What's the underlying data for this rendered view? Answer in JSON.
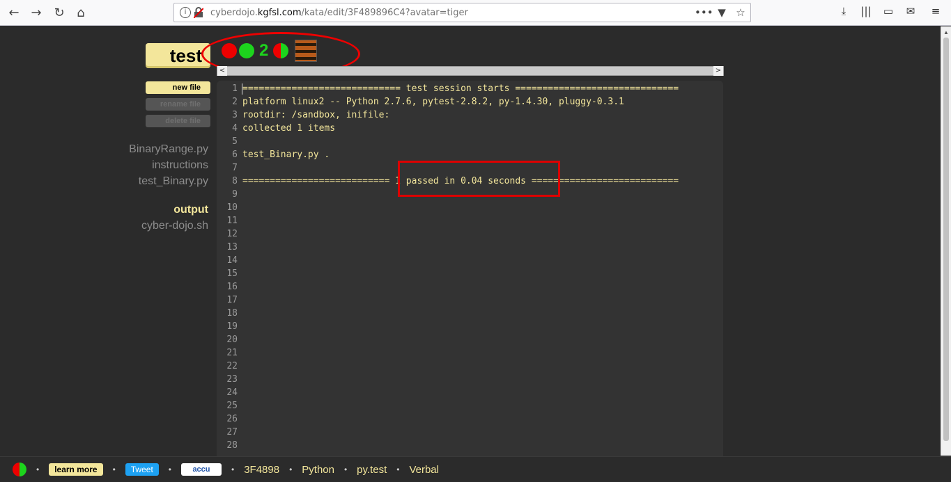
{
  "browser": {
    "url_prefix": "cyberdojo.",
    "url_domain": "kgfsl.com",
    "url_path": "/kata/edit/3F489896C4?avatar=tiger",
    "icons": {
      "back": "←",
      "forward": "→",
      "reload": "↻",
      "home": "⌂",
      "more": "•••",
      "bookmark": "☆",
      "download": "⤓",
      "library": "|||",
      "sidebar": "▭",
      "mail": "✉",
      "menu": "≡",
      "info": "i",
      "pocket": "▼"
    }
  },
  "app": {
    "test_button": "test",
    "new_file": "new file",
    "rename_file": "rename file",
    "delete_file": "delete file",
    "files": [
      "BinaryRange.py",
      "instructions",
      "test_Binary.py"
    ],
    "output_files": [
      "output",
      "cyber-dojo.sh"
    ],
    "selected_file": "output",
    "traffic_count": "2",
    "avatar": "tiger"
  },
  "editor": {
    "lines": [
      "============================= test session starts ==============================",
      "platform linux2 -- Python 2.7.6, pytest-2.8.2, py-1.4.30, pluggy-0.3.1",
      "rootdir: /sandbox, inifile:",
      "collected 1 items",
      "",
      "test_Binary.py .",
      "",
      "=========================== 1 passed in 0.04 seconds ===========================",
      "",
      "",
      "",
      "",
      "",
      "",
      "",
      "",
      "",
      "",
      "",
      "",
      "",
      "",
      "",
      "",
      "",
      "",
      "",
      "",
      ""
    ],
    "line_numbers": [
      "1",
      "2",
      "3",
      "4",
      "5",
      "6",
      "7",
      "8",
      "9",
      "10",
      "11",
      "12",
      "13",
      "14",
      "15",
      "16",
      "17",
      "18",
      "19",
      "20",
      "21",
      "22",
      "23",
      "24",
      "25",
      "26",
      "27",
      "28"
    ]
  },
  "footer": {
    "learn_more": "learn more",
    "tweet": "Tweet",
    "accu": "accu",
    "kata_id": "3F4898",
    "language": "Python",
    "test_framework": "py.test",
    "exercise": "Verbal",
    "separator": "•"
  },
  "colors": {
    "accent": "#f3e69b",
    "red": "#ee0000",
    "green": "#1dd41d",
    "background": "#2b2b2b"
  }
}
